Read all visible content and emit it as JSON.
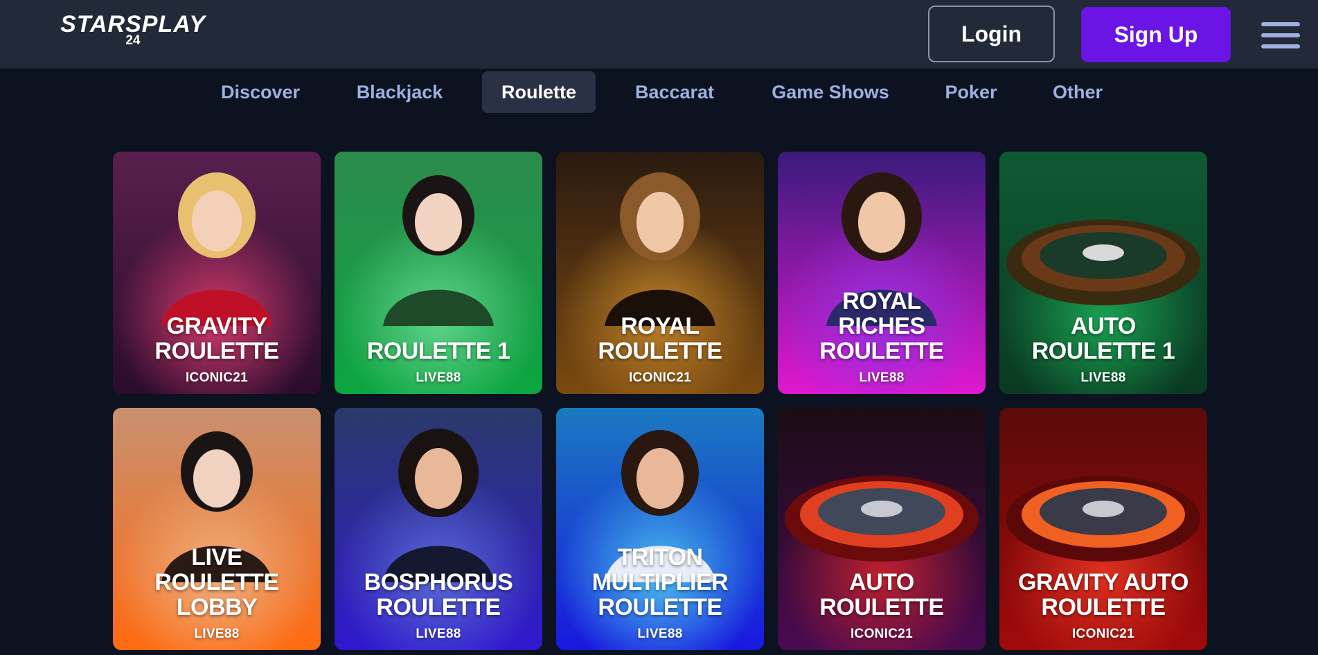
{
  "header": {
    "logo_text": "STARSPLAY",
    "logo_sub": "24",
    "login_label": "Login",
    "signup_label": "Sign Up",
    "menu_icon": "hamburger-menu-icon"
  },
  "tabs": [
    {
      "label": "Discover",
      "active": false
    },
    {
      "label": "Blackjack",
      "active": false
    },
    {
      "label": "Roulette",
      "active": true
    },
    {
      "label": "Baccarat",
      "active": false
    },
    {
      "label": "Game Shows",
      "active": false
    },
    {
      "label": "Poker",
      "active": false
    },
    {
      "label": "Other",
      "active": false
    }
  ],
  "games": [
    {
      "title": "GRAVITY\nROULETTE",
      "provider": "ICONIC21",
      "colors": [
        "#5a1f4e",
        "#2a0c2e"
      ],
      "glow": "#d43a6a"
    },
    {
      "title": "ROULETTE 1",
      "provider": "LIVE88",
      "colors": [
        "#2d8a4e",
        "#0ba640"
      ],
      "glow": "#5fd48a"
    },
    {
      "title": "ROYAL\nROULETTE",
      "provider": "ICONIC21",
      "colors": [
        "#2a1a10",
        "#7a4a10"
      ],
      "glow": "#c0822a"
    },
    {
      "title": "ROYAL\nRICHES\nROULETTE",
      "provider": "LIVE88",
      "colors": [
        "#3a1a7a",
        "#e018d0"
      ],
      "glow": "#9a30e0"
    },
    {
      "title": "AUTO\nROULETTE 1",
      "provider": "LIVE88",
      "colors": [
        "#0f5a32",
        "#0a3a22"
      ],
      "glow": "#19a050"
    },
    {
      "title": "LIVE\nROULETTE\nLOBBY",
      "provider": "LIVE88",
      "colors": [
        "#c89070",
        "#ff6a10"
      ],
      "glow": "#f0b080"
    },
    {
      "title": "BOSPHORUS\nROULETTE",
      "provider": "LIVE88",
      "colors": [
        "#2a3a6a",
        "#3018d0"
      ],
      "glow": "#5a6ad8"
    },
    {
      "title": "TRITON\nMULTIPLIER\nROULETTE",
      "provider": "LIVE88",
      "colors": [
        "#1a7ac0",
        "#1818e0"
      ],
      "glow": "#4ac0f0"
    },
    {
      "title": "AUTO\nROULETTE",
      "provider": "ICONIC21",
      "colors": [
        "#1a0c14",
        "#4a0a52"
      ],
      "glow": "#c02030"
    },
    {
      "title": "GRAVITY AUTO\nROULETTE",
      "provider": "ICONIC21",
      "colors": [
        "#5a0a0a",
        "#a00a0a"
      ],
      "glow": "#e03020"
    }
  ]
}
